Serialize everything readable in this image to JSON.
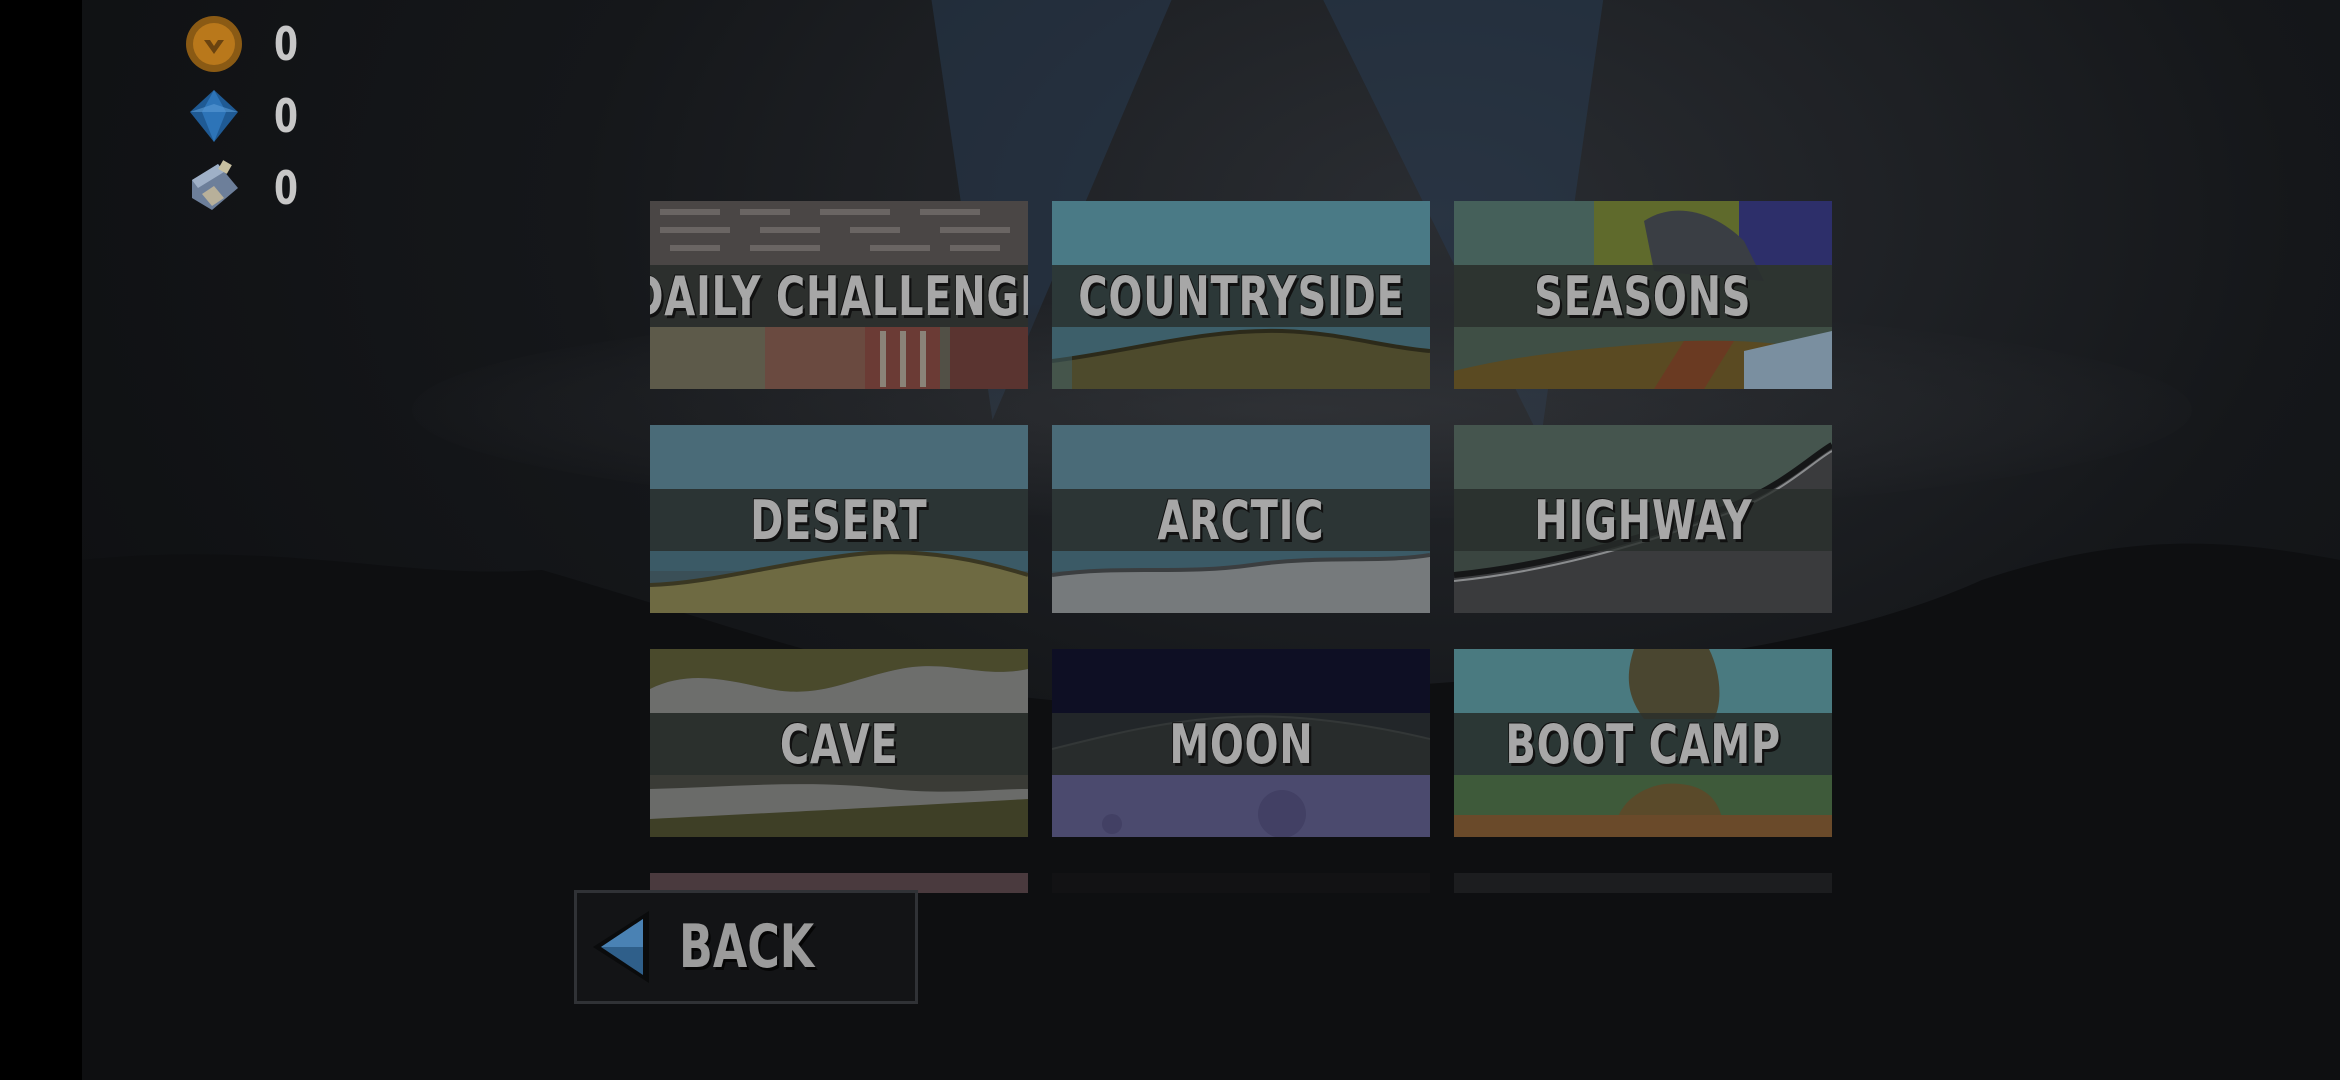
{
  "currency": [
    {
      "icon": "coin-icon",
      "value": "0",
      "color": "#b9781b"
    },
    {
      "icon": "diamond-icon",
      "value": "0",
      "color": "#2d74b8"
    },
    {
      "icon": "fuel-can-icon",
      "value": "0",
      "color": "#6d7f9a"
    }
  ],
  "levels": [
    {
      "label": "DAILY CHALLENGE",
      "theme": "daily"
    },
    {
      "label": "COUNTRYSIDE",
      "theme": "countryside"
    },
    {
      "label": "SEASONS",
      "theme": "seasons"
    },
    {
      "label": "DESERT",
      "theme": "desert"
    },
    {
      "label": "ARCTIC",
      "theme": "arctic"
    },
    {
      "label": "HIGHWAY",
      "theme": "highway"
    },
    {
      "label": "CAVE",
      "theme": "cave"
    },
    {
      "label": "MOON",
      "theme": "moon"
    },
    {
      "label": "BOOT CAMP",
      "theme": "bootcamp"
    }
  ],
  "back_button": {
    "label": "BACK",
    "icon": "back-arrow-icon"
  },
  "colors": {
    "label_text": "#a7a7a7",
    "label_band": "#2d322f",
    "overlay_dim": "#0b0c0e"
  }
}
